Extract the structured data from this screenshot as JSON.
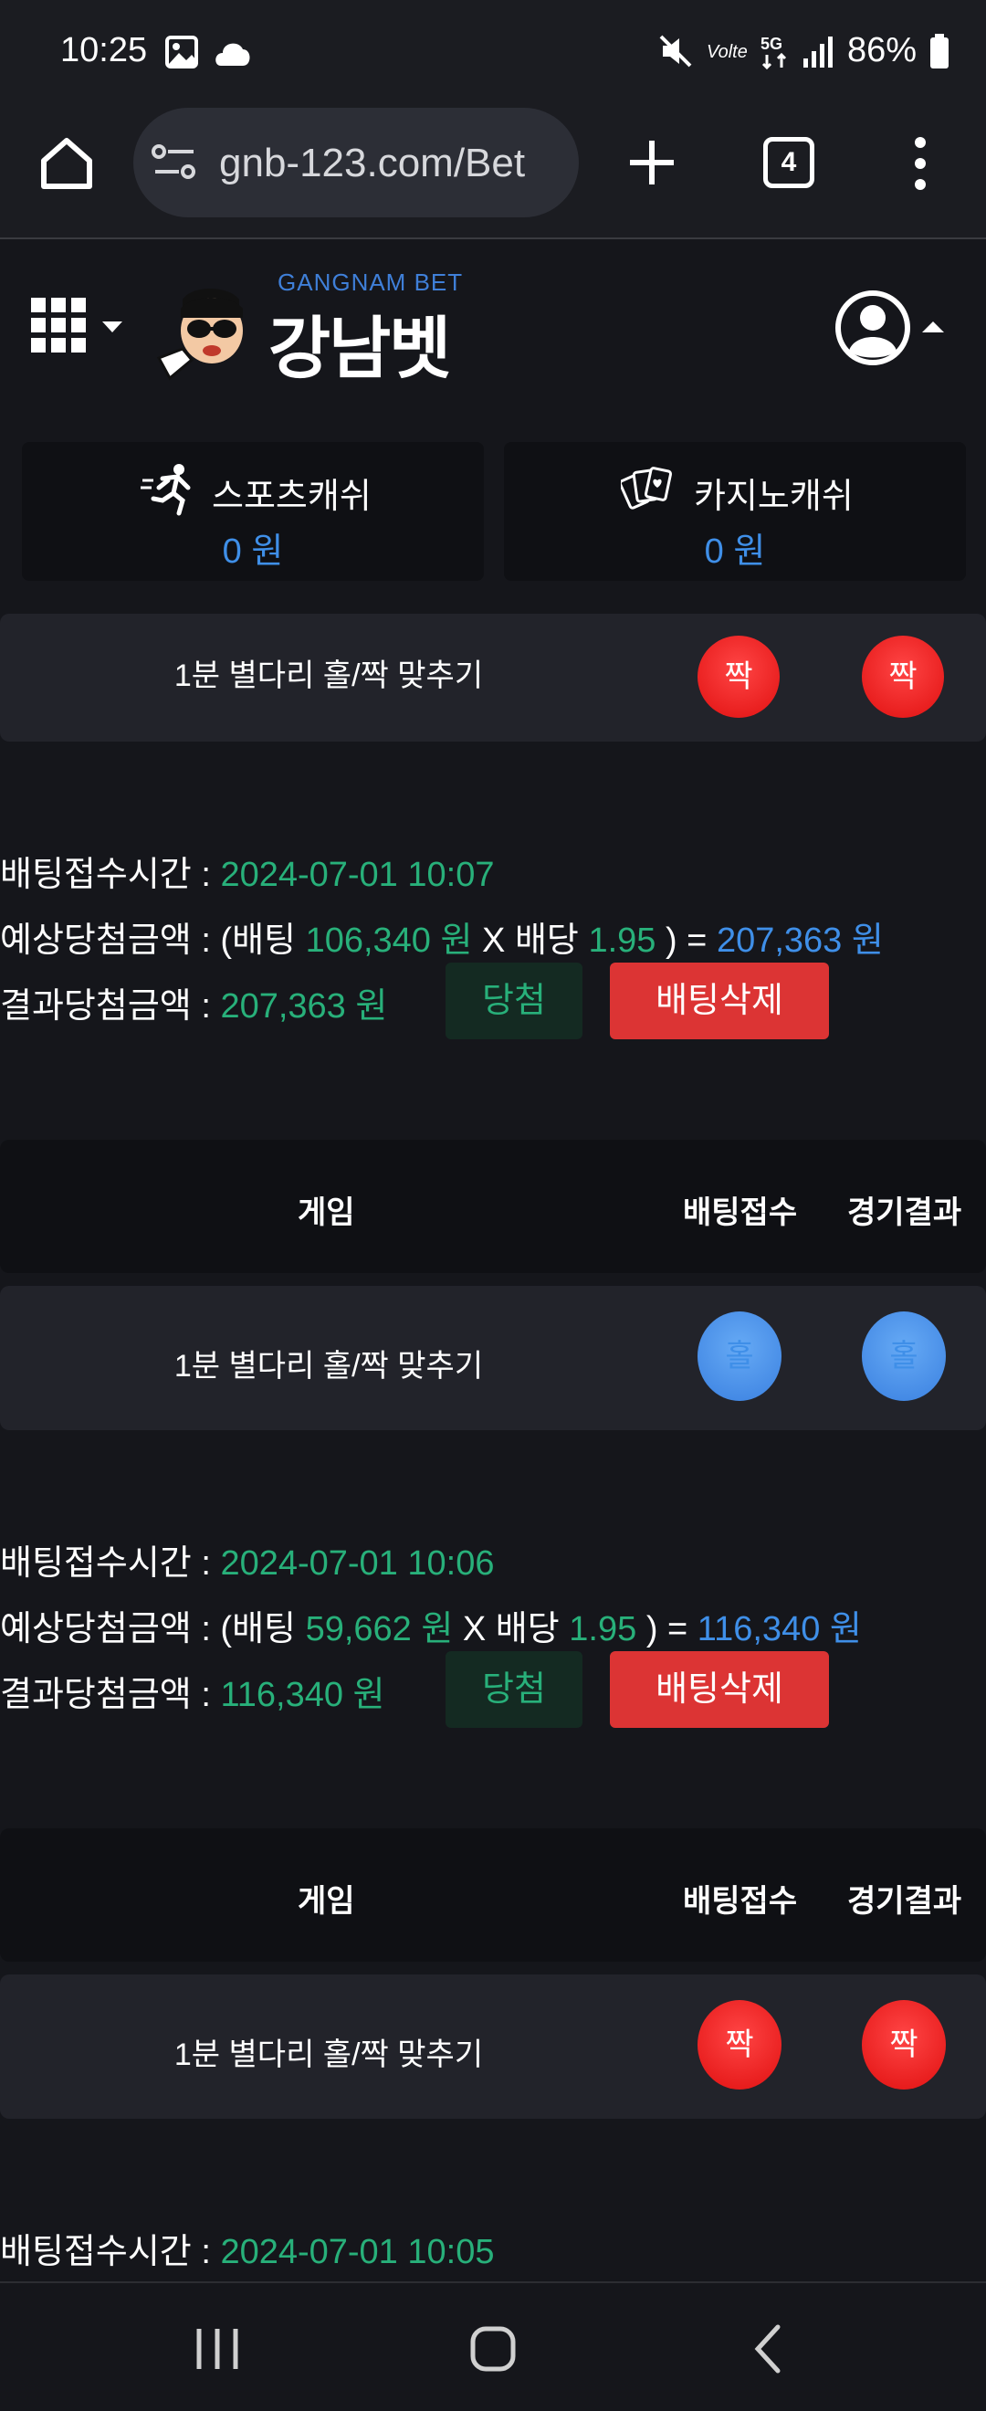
{
  "status": {
    "time": "10:25",
    "battery": "86%"
  },
  "browser": {
    "url": "gnb-123.com/Bet",
    "tab_count": "4"
  },
  "site": {
    "logo_sub": "GANGNAM BET",
    "logo_main": "강남벳"
  },
  "cash": {
    "sports_label": "스포츠캐쉬",
    "sports_value": "0 원",
    "casino_label": "카지노캐쉬",
    "casino_value": "0 원"
  },
  "table_headers": {
    "game": "게임",
    "bet": "배팅접수",
    "result": "경기결과"
  },
  "labels": {
    "bet_time": "배팅접수시간 : ",
    "expected_prefix": "예상당첨금액 : (배팅 ",
    "won": " 원",
    "x_odds": " X 배당 ",
    "close_eq": " ) = ",
    "result_amount": "결과당첨금액 : ",
    "win": "당첨",
    "delete": "배팅삭제"
  },
  "bets": [
    {
      "game": "1분 별다리 홀/짝 맞추기",
      "pick": "짝",
      "result": "짝",
      "color": "#e81818",
      "time": "2024-07-01 10:07",
      "stake": "106,340",
      "odds": "1.95",
      "expected": "207,363 원",
      "result_amount": "207,363 원"
    },
    {
      "game": "1분 별다리 홀/짝 맞추기",
      "pick": "홀",
      "result": "홀",
      "color": "#3f86e4",
      "time": "2024-07-01 10:06",
      "stake": "59,662",
      "odds": "1.95",
      "expected": "116,340 원",
      "result_amount": "116,340 원"
    },
    {
      "game": "1분 별다리 홀/짝 맞추기",
      "pick": "짝",
      "result": "짝",
      "color": "#e81818",
      "time": "2024-07-01 10:05"
    }
  ]
}
